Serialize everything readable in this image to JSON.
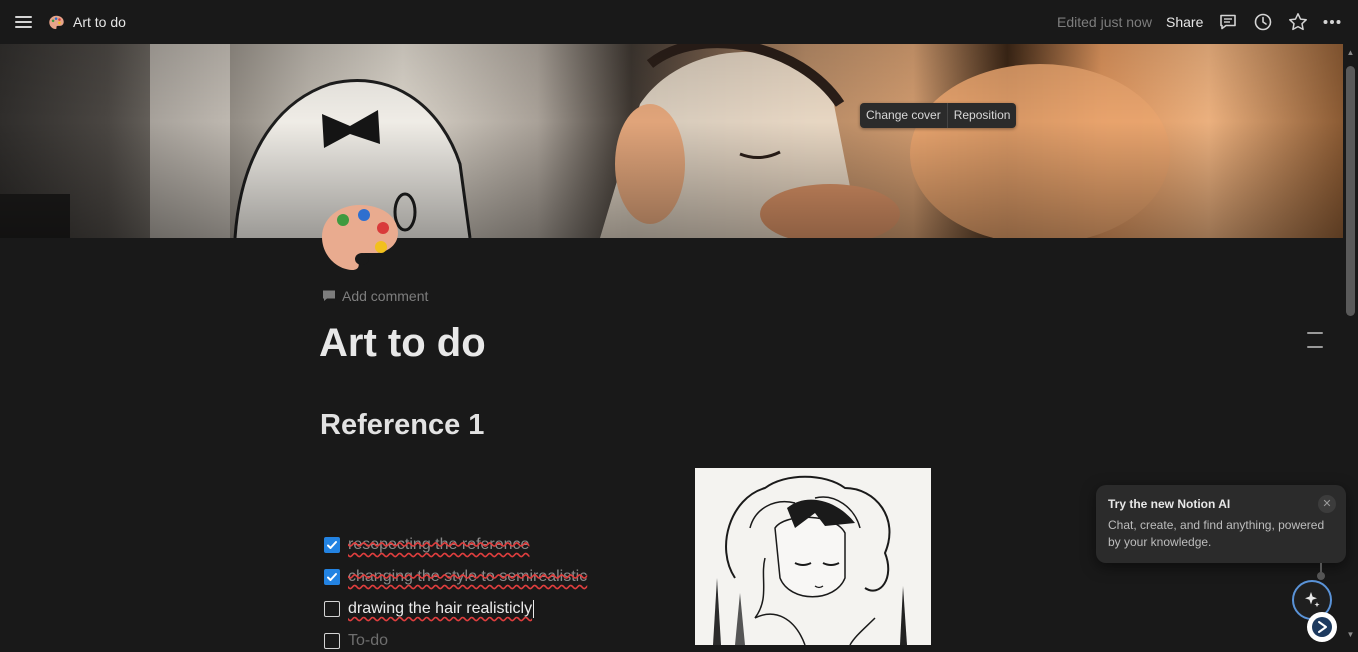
{
  "topbar": {
    "page_title": "Art to do",
    "page_icon": "palette-icon",
    "edited_status": "Edited just now",
    "share_label": "Share",
    "icons": [
      "menu-icon",
      "comments-icon",
      "history-icon",
      "favorite-star-icon",
      "more-icon"
    ]
  },
  "cover": {
    "change_cover_label": "Change cover",
    "reposition_label": "Reposition"
  },
  "page": {
    "icon": "palette-icon",
    "add_comment_label": "Add comment",
    "title": "Art to do",
    "heading": "Reference 1",
    "todos": [
      {
        "text": "resepecting the reference",
        "checked": true
      },
      {
        "text": "changing the style to semirealistic",
        "checked": true
      },
      {
        "text": "drawing the hair realisticly",
        "checked": false
      },
      {
        "text": "To-do",
        "checked": false,
        "placeholder": true
      }
    ]
  },
  "ai_popup": {
    "title": "Try the new Notion AI",
    "body": "Chat, create, and find anything, powered by your knowledge.",
    "close_icon": "close-icon"
  },
  "colors": {
    "background": "#191919",
    "checkbox_checked": "#2383e2",
    "spellcheck_underline": "#e03e3e",
    "ai_ring": "#5a93d8"
  }
}
